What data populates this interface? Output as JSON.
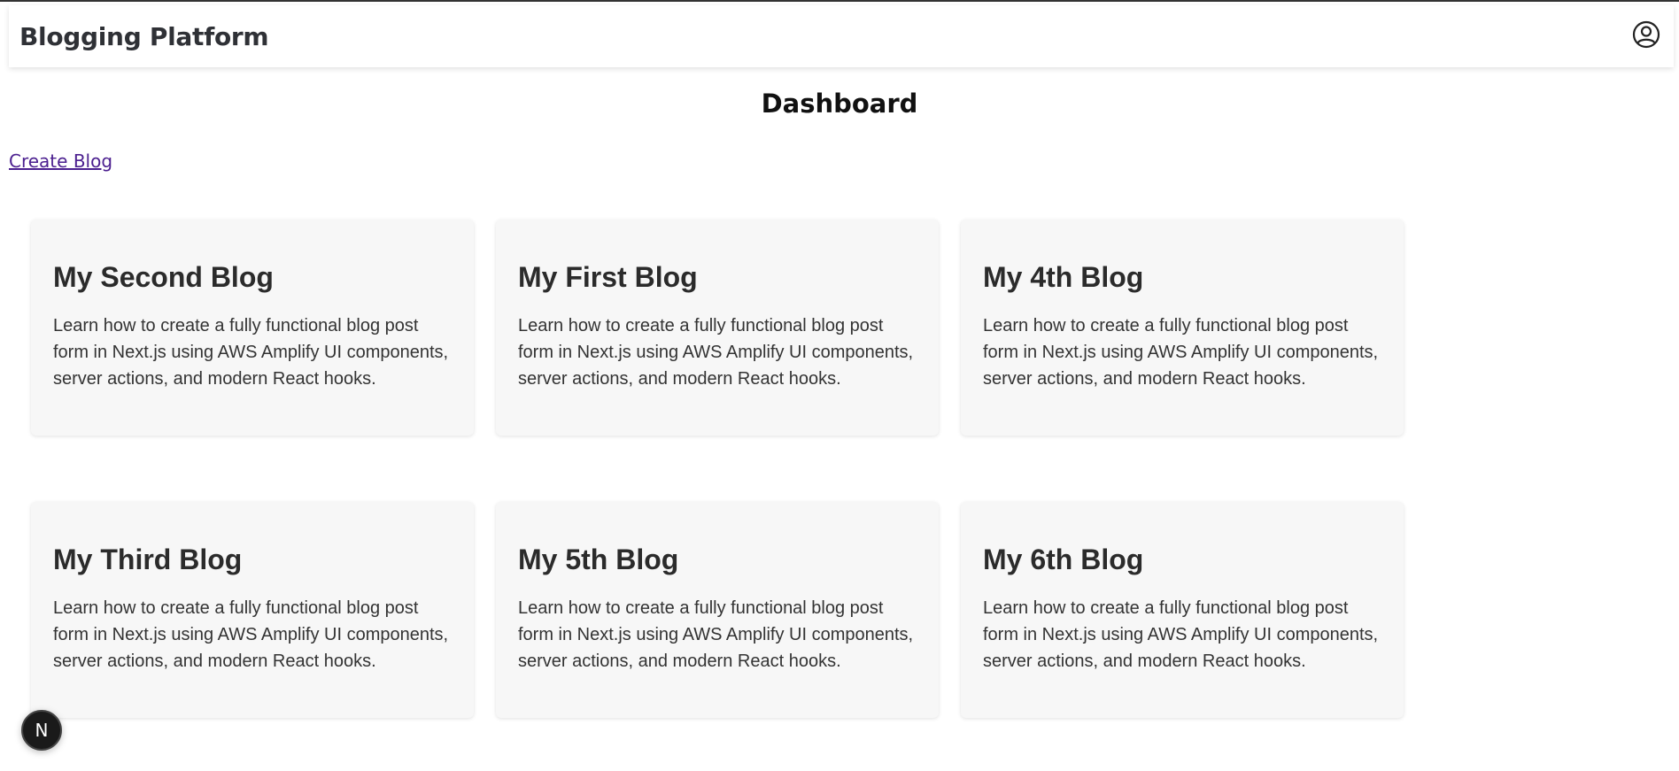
{
  "header": {
    "brand": "Blogging Platform",
    "account_icon": "user-circle-icon"
  },
  "main": {
    "title": "Dashboard",
    "create_link": "Create Blog",
    "blogs": [
      {
        "title": "My Second Blog",
        "excerpt": "Learn how to create a fully functional blog post form in Next.js using AWS Amplify UI components, server actions, and modern React hooks."
      },
      {
        "title": "My First Blog",
        "excerpt": "Learn how to create a fully functional blog post form in Next.js using AWS Amplify UI components, server actions, and modern React hooks."
      },
      {
        "title": "My 4th Blog",
        "excerpt": "Learn how to create a fully functional blog post form in Next.js using AWS Amplify UI components, server actions, and modern React hooks."
      },
      {
        "title": "My Third Blog",
        "excerpt": "Learn how to create a fully functional blog post form in Next.js using AWS Amplify UI components, server actions, and modern React hooks."
      },
      {
        "title": "My 5th Blog",
        "excerpt": "Learn how to create a fully functional blog post form in Next.js using AWS Amplify UI components, server actions, and modern React hooks."
      },
      {
        "title": "My 6th Blog",
        "excerpt": "Learn how to create a fully functional blog post form in Next.js using AWS Amplify UI components, server actions, and modern React hooks."
      }
    ]
  },
  "dev_badge": {
    "label": "N",
    "icon": "nextjs-logo-icon"
  },
  "colors": {
    "link": "#4b1f8f",
    "card_bg": "#f7f7f7",
    "badge_bg": "#1a1a1a"
  }
}
